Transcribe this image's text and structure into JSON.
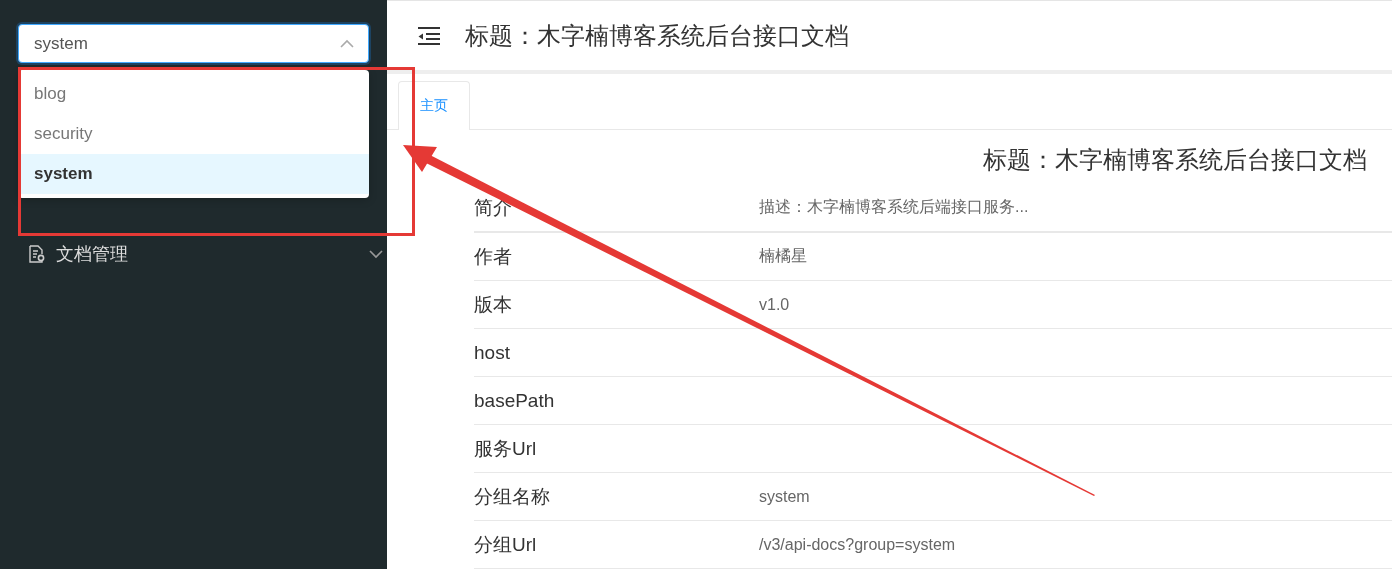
{
  "sidebar": {
    "group_select": {
      "value": "system",
      "expanded": true,
      "options": [
        {
          "label": "blog",
          "selected": false
        },
        {
          "label": "security",
          "selected": false
        },
        {
          "label": "system",
          "selected": true
        }
      ]
    },
    "menu": [
      {
        "label": "文档管理",
        "expanded": false
      }
    ]
  },
  "header": {
    "title": "标题：木字楠博客系统后台接口文档"
  },
  "tabs": [
    {
      "label": "主页",
      "selected": true
    }
  ],
  "doc": {
    "heading": "标题：木字楠博客系统后台接口文档",
    "rows": [
      {
        "label": "简介",
        "value": "描述：木字楠博客系统后端接口服务..."
      },
      {
        "label": "作者",
        "value": "楠橘星"
      },
      {
        "label": "版本",
        "value": "v1.0"
      },
      {
        "label": "host"
      },
      {
        "label": "basePath"
      },
      {
        "label": "服务Url"
      },
      {
        "label": "分组名称",
        "value": "system"
      },
      {
        "label": "分组Url",
        "value": "/v3/api-docs?group=system"
      }
    ]
  },
  "annotations": {
    "highlight_frame": true,
    "arrow": true
  }
}
